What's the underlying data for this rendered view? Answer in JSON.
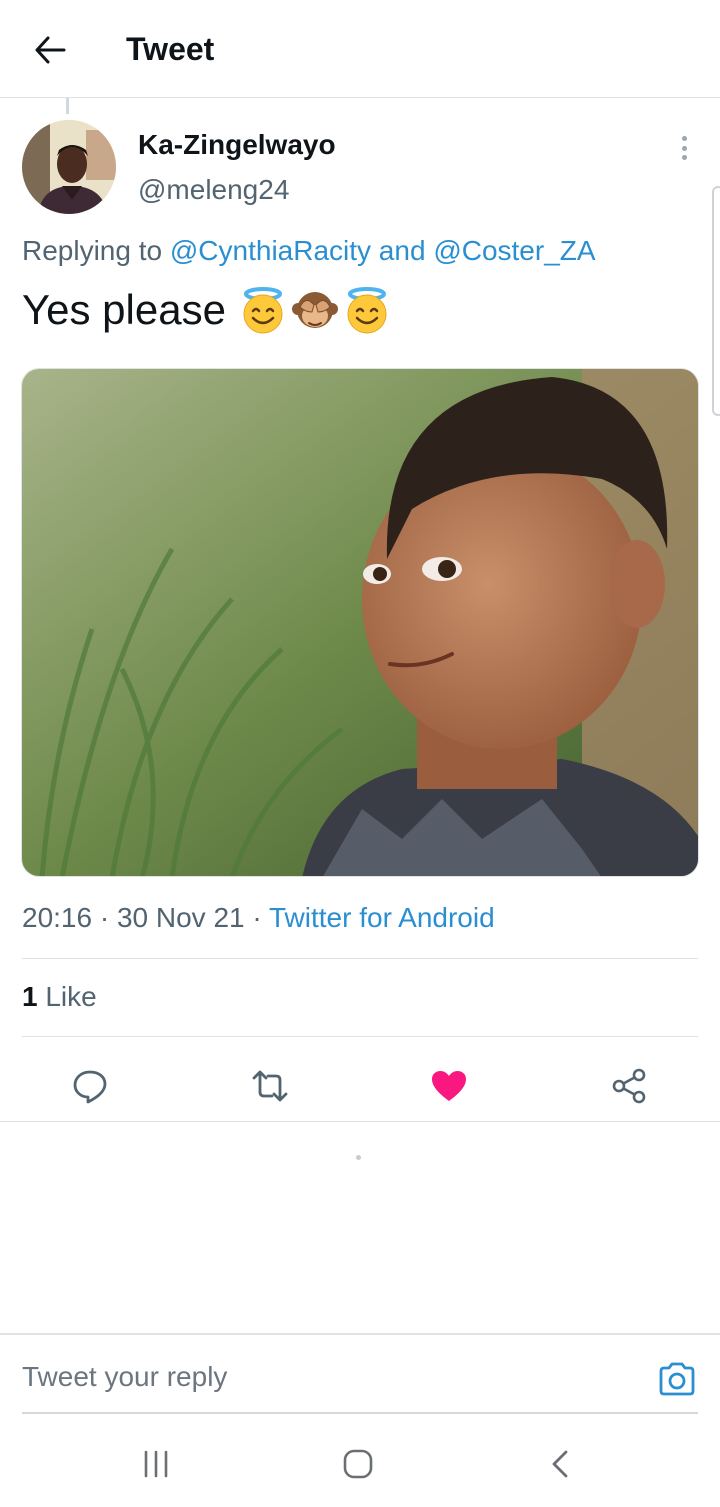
{
  "header": {
    "title": "Tweet",
    "back_icon": "arrow-left-icon"
  },
  "tweet": {
    "author": {
      "name": "Ka-Zingelwayo",
      "handle": "@meleng24"
    },
    "replying": {
      "prefix": "Replying to ",
      "mention1": "@CynthiaRacity",
      "connector": " and ",
      "mention2": "@Coster_ZA"
    },
    "text": "Yes please",
    "emojis": [
      "smiling-face-with-halo",
      "see-no-evil-monkey",
      "smiling-face-with-halo"
    ],
    "time": "20:16",
    "date": "30 Nov 21",
    "separator": " · ",
    "source": "Twitter for Android",
    "likes": {
      "count": "1",
      "label": " Like"
    }
  },
  "actions": [
    "reply-icon",
    "retweet-icon",
    "heart-icon",
    "share-icon"
  ],
  "reply": {
    "placeholder": "Tweet your reply",
    "camera_icon": "camera-icon"
  },
  "navbar": [
    "recent-apps-icon",
    "home-icon",
    "back-icon"
  ],
  "colors": {
    "link": "#2a8fd1",
    "like": "#f91880",
    "muted": "#536471"
  }
}
